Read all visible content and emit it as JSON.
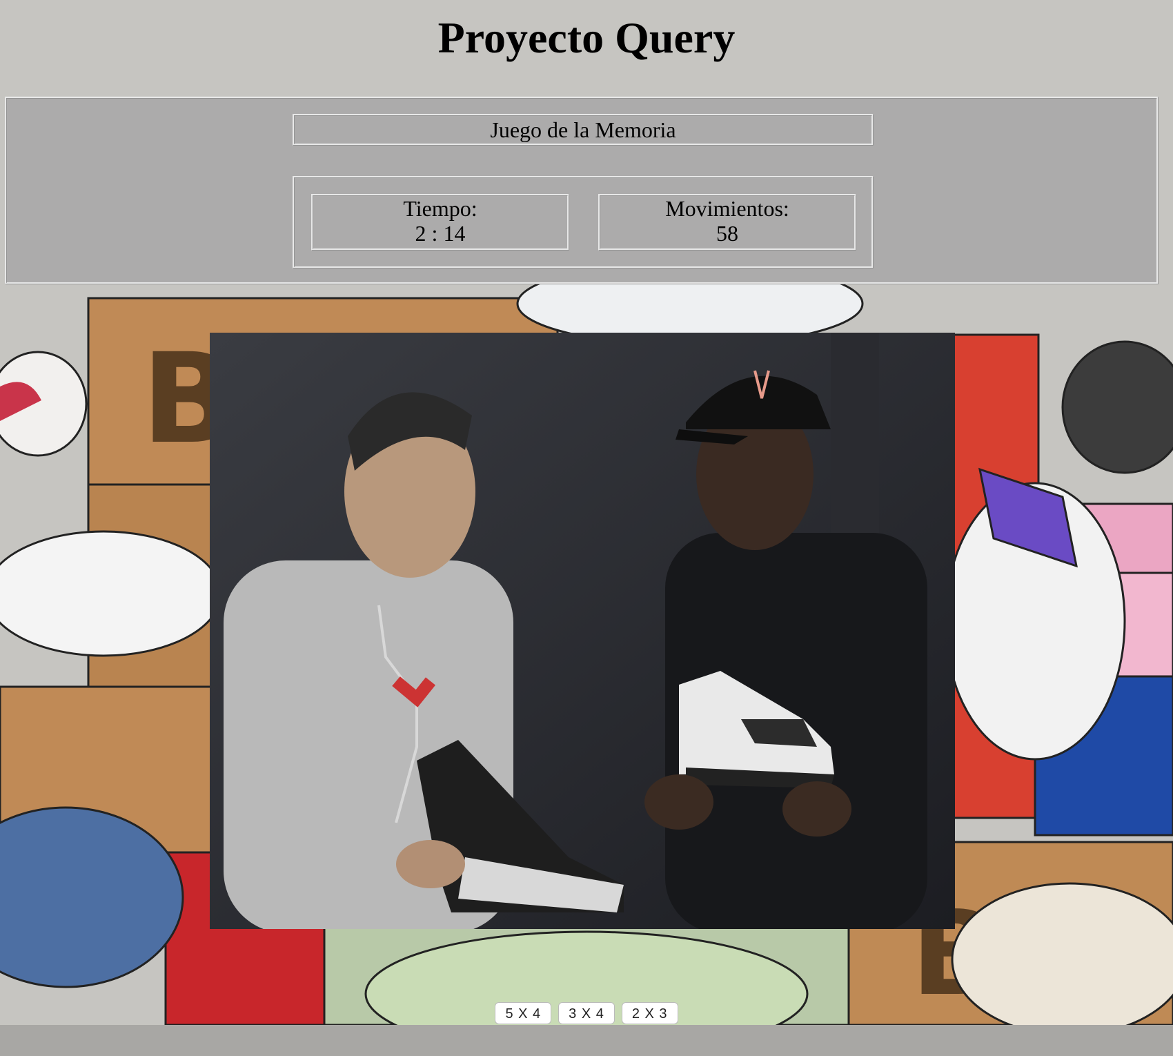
{
  "page": {
    "title": "Proyecto Query"
  },
  "panel": {
    "game_name": "Juego de la Memoria",
    "time": {
      "label": "Tiempo:",
      "value": "2 : 14"
    },
    "moves": {
      "label": "Movimientos:",
      "value": "58"
    }
  },
  "levels": [
    {
      "label": "5 X 4"
    },
    {
      "label": "3 X 4"
    },
    {
      "label": "2 X 3"
    }
  ],
  "colors": {
    "page_background": "#c6c5c1",
    "panel_background": "#acabab",
    "button_background": "#ffffff"
  }
}
